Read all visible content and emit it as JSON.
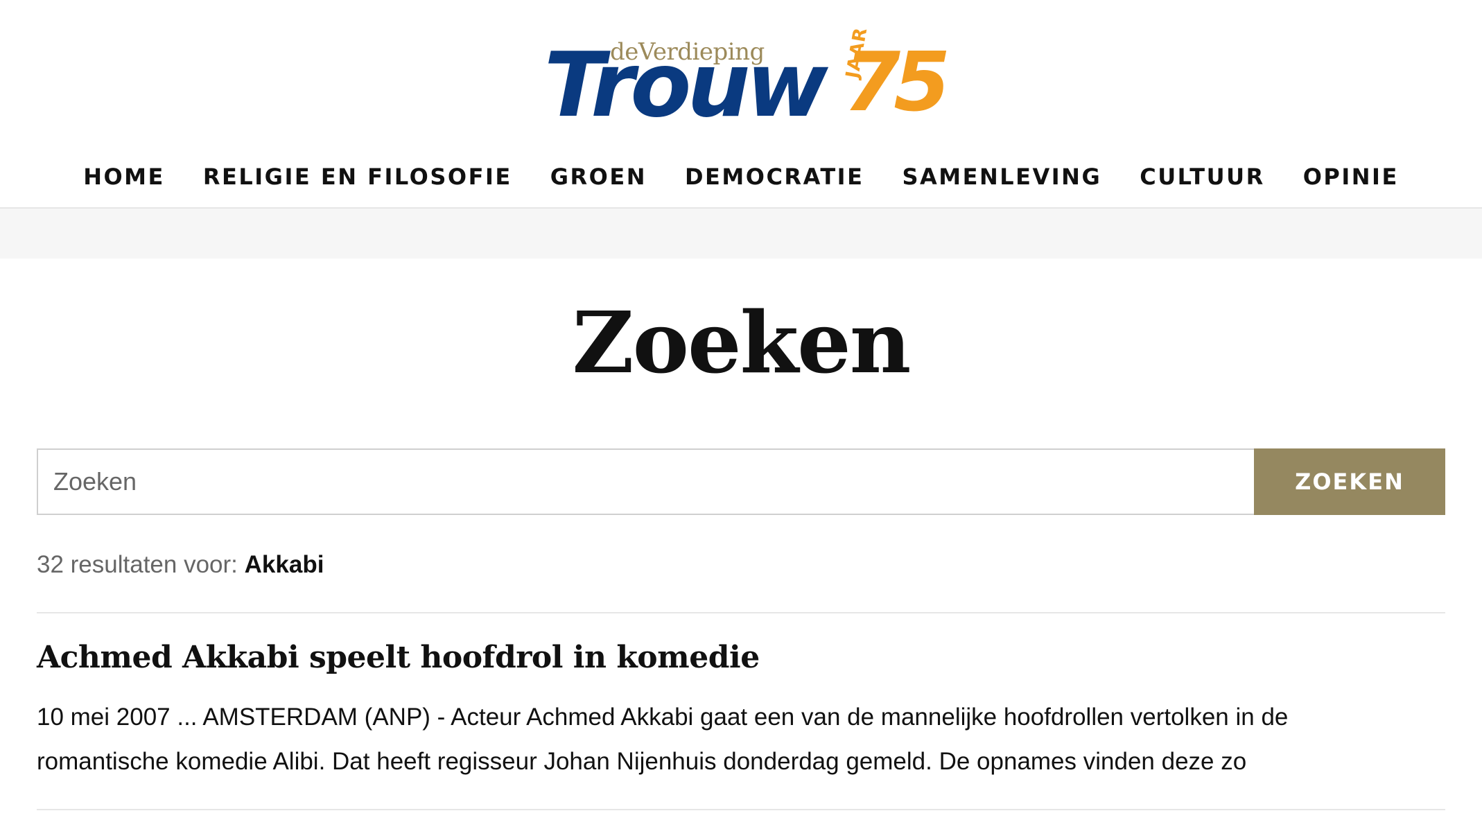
{
  "header": {
    "logo": {
      "subtitle": "deVerdieping",
      "name": "Trouw",
      "jaar": "JAAR",
      "number": "75",
      "colors": {
        "name": "#0a3a80",
        "accent": "#f39c1f",
        "subtitle": "#9c8a5a"
      }
    },
    "nav": [
      {
        "label": "HOME"
      },
      {
        "label": "RELIGIE EN FILOSOFIE"
      },
      {
        "label": "GROEN"
      },
      {
        "label": "DEMOCRATIE"
      },
      {
        "label": "SAMENLEVING"
      },
      {
        "label": "CULTUUR"
      },
      {
        "label": "OPINIE"
      }
    ]
  },
  "main": {
    "title": "Zoeken",
    "search": {
      "placeholder": "Zoeken",
      "value": "",
      "button_label": "ZOEKEN",
      "button_color": "#958860"
    },
    "results_summary": {
      "count_text": "32 resultaten voor:",
      "query": "Akkabi"
    },
    "results": [
      {
        "title": "Achmed Akkabi speelt hoofdrol in komedie",
        "snippet": "10 mei 2007 ... AMSTERDAM (ANP) - Acteur Achmed Akkabi gaat een van de mannelijke hoofdrollen vertolken in de romantische komedie Alibi. Dat heeft regisseur Johan Nijenhuis donderdag gemeld. De opnames vinden deze zo"
      }
    ]
  }
}
